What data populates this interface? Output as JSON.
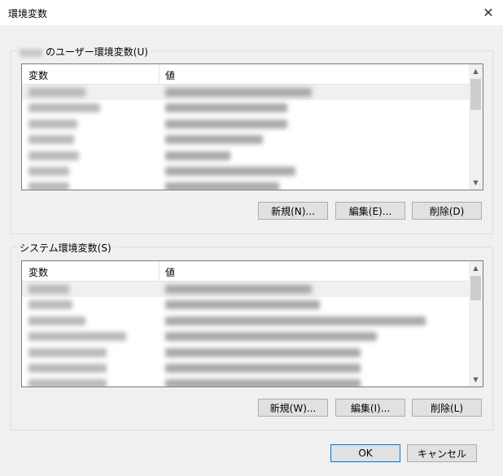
{
  "window": {
    "title": "環境変数",
    "close_label": "✕"
  },
  "user_section": {
    "label": "のユーザー環境変数(U)",
    "columns": {
      "name": "変数",
      "value": "値"
    },
    "rows": [
      {
        "name_w": 70,
        "value_w": 180,
        "selected": true
      },
      {
        "name_w": 88,
        "value_w": 150,
        "selected": false
      },
      {
        "name_w": 60,
        "value_w": 150,
        "selected": false
      },
      {
        "name_w": 56,
        "value_w": 120,
        "selected": false
      },
      {
        "name_w": 62,
        "value_w": 80,
        "selected": false
      },
      {
        "name_w": 50,
        "value_w": 160,
        "selected": false
      },
      {
        "name_w": 50,
        "value_w": 140,
        "selected": false
      }
    ],
    "buttons": {
      "new": "新規(N)...",
      "edit": "編集(E)...",
      "delete": "削除(D)"
    }
  },
  "system_section": {
    "label": "システム環境変数(S)",
    "columns": {
      "name": "変数",
      "value": "値"
    },
    "rows": [
      {
        "name_w": 50,
        "value_w": 180,
        "selected": true
      },
      {
        "name_w": 54,
        "value_w": 190,
        "selected": false
      },
      {
        "name_w": 70,
        "value_w": 320,
        "selected": false
      },
      {
        "name_w": 120,
        "value_w": 260,
        "selected": false
      },
      {
        "name_w": 96,
        "value_w": 240,
        "selected": false
      },
      {
        "name_w": 96,
        "value_w": 240,
        "selected": false
      },
      {
        "name_w": 96,
        "value_w": 240,
        "selected": false
      }
    ],
    "buttons": {
      "new": "新規(W)...",
      "edit": "編集(I)...",
      "delete": "削除(L)"
    }
  },
  "footer": {
    "ok": "OK",
    "cancel": "キャンセル"
  }
}
